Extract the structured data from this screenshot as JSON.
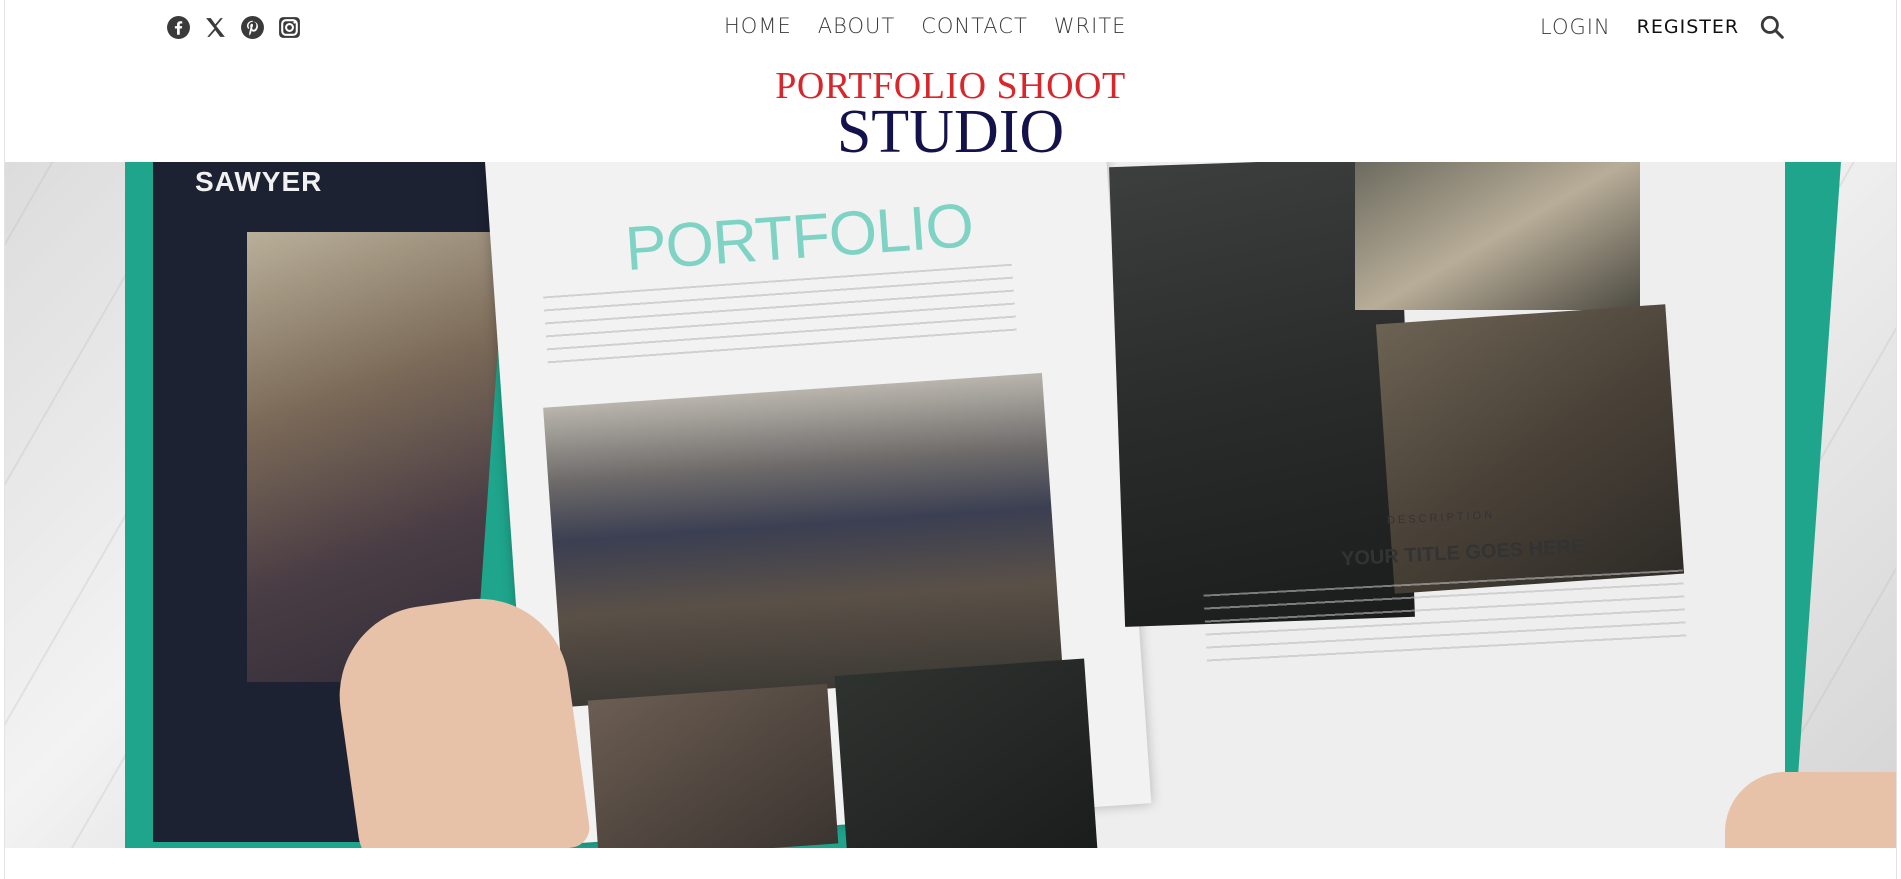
{
  "social": [
    {
      "name": "facebook"
    },
    {
      "name": "x-twitter"
    },
    {
      "name": "pinterest"
    },
    {
      "name": "instagram"
    }
  ],
  "nav": {
    "items": [
      "HOME",
      "ABOUT",
      "CONTACT",
      "WRITE"
    ]
  },
  "auth": {
    "login_label": "LOGIN",
    "register_label": "REGISTER"
  },
  "brand": {
    "line1": "PORTFOLIO SHOOT",
    "line2": "STUDIO"
  },
  "hero": {
    "back_cover_title": "SAWYER",
    "page_heading": "PORTFOLIO",
    "description_label": "DESCRIPTION",
    "description_title": "YOUR TITLE GOES HERE"
  },
  "colors": {
    "brand_red": "#d8262b",
    "brand_navy": "#14124a",
    "book_teal": "#1fa58c"
  }
}
